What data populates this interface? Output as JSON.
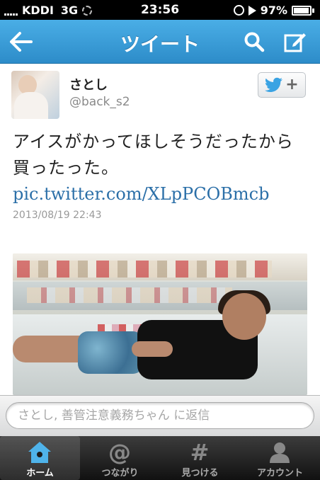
{
  "status_bar": {
    "carrier": "KDDI",
    "network": "3G",
    "time": "23:56",
    "battery": "97%"
  },
  "nav": {
    "title": "ツイート",
    "back_icon": "back-arrow-icon",
    "search_icon": "search-icon",
    "compose_icon": "compose-icon"
  },
  "tweet": {
    "name": "さとし",
    "handle": "@back_s2",
    "text": "アイスがかってほしそうだったから買ったった。",
    "link": "pic.twitter.com/XLpPCOBmcb",
    "timestamp": "2013/08/19 22:43",
    "follow_button_icon": "twitter-bird-icon",
    "follow_button_label": "+"
  },
  "reply": {
    "placeholder": "さとし, 善管注意義務ちゃん に返信"
  },
  "tabs": [
    {
      "label": "ホーム",
      "icon": "home-icon",
      "active": true
    },
    {
      "label": "つながり",
      "icon": "at-icon",
      "active": false
    },
    {
      "label": "見つける",
      "icon": "hash-icon",
      "active": false
    },
    {
      "label": "アカウント",
      "icon": "person-icon",
      "active": false
    }
  ],
  "colors": {
    "nav_blue": "#2d8cc9",
    "link_blue": "#2b6fa8",
    "tab_active_icon": "#4fb3ea"
  }
}
